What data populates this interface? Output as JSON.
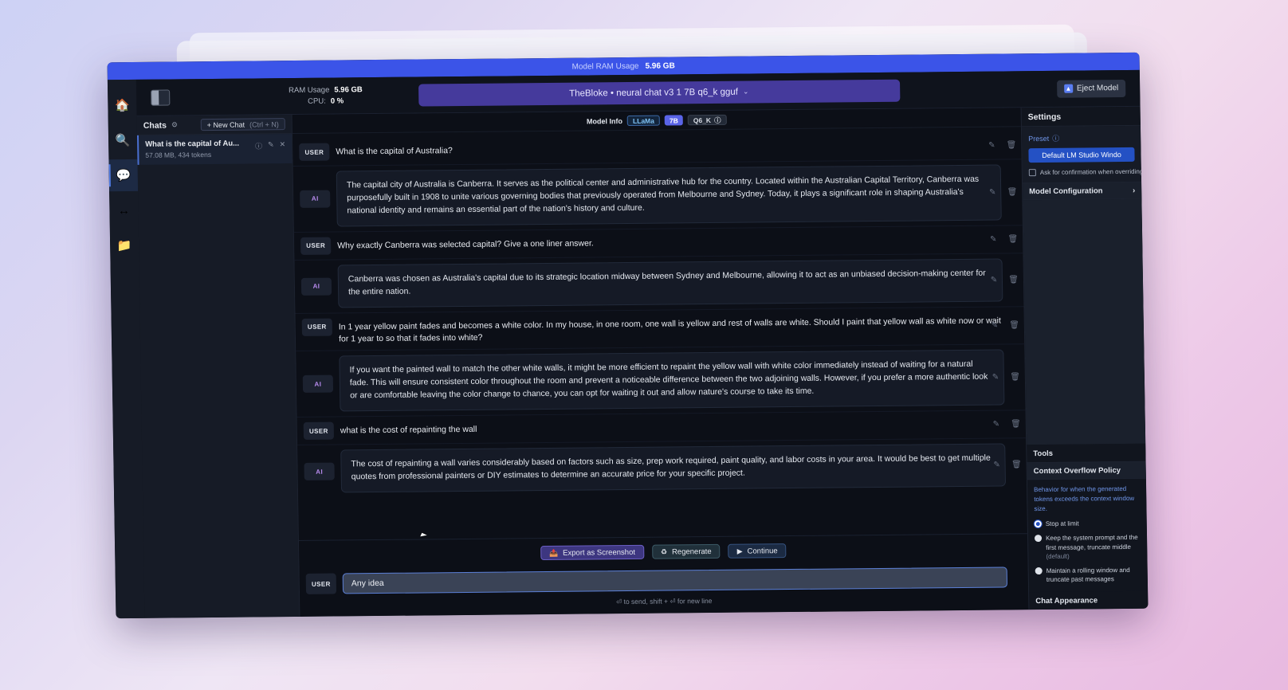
{
  "titlebar": {
    "label": "Model RAM Usage",
    "value": "5.96 GB"
  },
  "rail": {
    "items": [
      {
        "name": "home",
        "icon": "🏠"
      },
      {
        "name": "search",
        "icon": "🔍"
      },
      {
        "name": "chat",
        "icon": "💬"
      },
      {
        "name": "resize",
        "icon": "↔"
      },
      {
        "name": "folder",
        "icon": "📁"
      }
    ]
  },
  "topbar": {
    "ram_label": "RAM Usage",
    "ram_value": "5.96 GB",
    "cpu_label": "CPU:",
    "cpu_value": "0 %",
    "model_name": "TheBloke • neural chat v3 1 7B q6_k gguf",
    "caret": "⌄",
    "eject_label": "Eject Model",
    "eject_badge": "▲"
  },
  "sidebar": {
    "title": "Chats",
    "gear": "⚙",
    "new_chat_label": "+ New Chat",
    "new_chat_shortcut": "(Ctrl + N)",
    "items": [
      {
        "title": "What is the capital of Au...",
        "meta": "57.08 MB, 434 tokens",
        "actions": [
          "ⓘ",
          "✎",
          "✕"
        ]
      }
    ]
  },
  "model_info": {
    "label": "Model Info",
    "arch": "LLaMa",
    "params": "7B",
    "quant": "Q6_K",
    "quant_info": "ⓘ"
  },
  "messages": [
    {
      "role": "USER",
      "text": "What is the capital of Australia?"
    },
    {
      "role": "AI",
      "text": "The capital city of Australia is Canberra. It serves as the political center and administrative hub for the country. Located within the Australian Capital Territory, Canberra was purposefully built in 1908 to unite various governing bodies that previously operated from Melbourne and Sydney. Today, it plays a significant role in shaping Australia's national identity and remains an essential part of the nation's history and culture."
    },
    {
      "role": "USER",
      "text": "Why exactly Canberra was selected capital? Give a one liner answer."
    },
    {
      "role": "AI",
      "text": "Canberra was chosen as Australia's capital due to its strategic location midway between Sydney and Melbourne, allowing it to act as an unbiased decision-making center for the entire nation."
    },
    {
      "role": "USER",
      "text": "In 1 year yellow paint fades and becomes a white color. In my house, in one room, one wall is yellow and rest of walls are white. Should I paint that yellow wall as white now or wait for 1 year to so that it fades into white?"
    },
    {
      "role": "AI",
      "text": "If you want the painted wall to match the other white walls, it might be more efficient to repaint the yellow wall with white color immediately instead of waiting for a natural fade. This will ensure consistent color throughout the room and prevent a noticeable difference between the two adjoining walls. However, if you prefer a more authentic look or are comfortable leaving the color change to chance, you can opt for waiting it out and allow nature's course to take its time."
    },
    {
      "role": "USER",
      "text": "what is the cost of repainting the wall"
    },
    {
      "role": "AI",
      "text": "The cost of repainting a wall varies considerably based on factors such as size, prep work required, paint quality, and labor costs in your area. It would be best to get multiple quotes from professional painters or DIY estimates to determine an accurate price for your specific project."
    }
  ],
  "msg_actions": {
    "edit": "✎",
    "delete": "🗑"
  },
  "actions": [
    {
      "label": "Export as Screenshot",
      "icon": "📤"
    },
    {
      "label": "Regenerate",
      "icon": "♻"
    },
    {
      "label": "Continue",
      "icon": "▶"
    }
  ],
  "composer": {
    "role": "USER",
    "value": "Any idea",
    "placeholder": "Any idea",
    "hint": "⏎ to send, shift + ⏎ for new line"
  },
  "settings": {
    "title": "Settings",
    "preset_label": "Preset",
    "preset_info": "ⓘ",
    "preset_value": "Default LM Studio Windo",
    "confirm_label": "Ask for confirmation when overriding",
    "model_config": "Model Configuration",
    "model_config_chevron": "›",
    "tools_title": "Tools",
    "context_policy_title": "Context Overflow Policy",
    "context_policy_desc": "Behavior for when the generated tokens exceeds the context window size.",
    "options": [
      {
        "label": "Stop at limit",
        "selected": true,
        "suffix": ""
      },
      {
        "label": "Keep the system prompt and the first message, truncate middle",
        "selected": false,
        "suffix": " (default)"
      },
      {
        "label": "Maintain a rolling window and truncate past messages",
        "selected": false,
        "suffix": ""
      }
    ],
    "chat_appearance": "Chat Appearance"
  },
  "colors": {
    "accent_blue": "#3b54e8",
    "model_pill": "#453a9c",
    "preset_blue": "#2451c4",
    "window_bg": "#12161f"
  }
}
